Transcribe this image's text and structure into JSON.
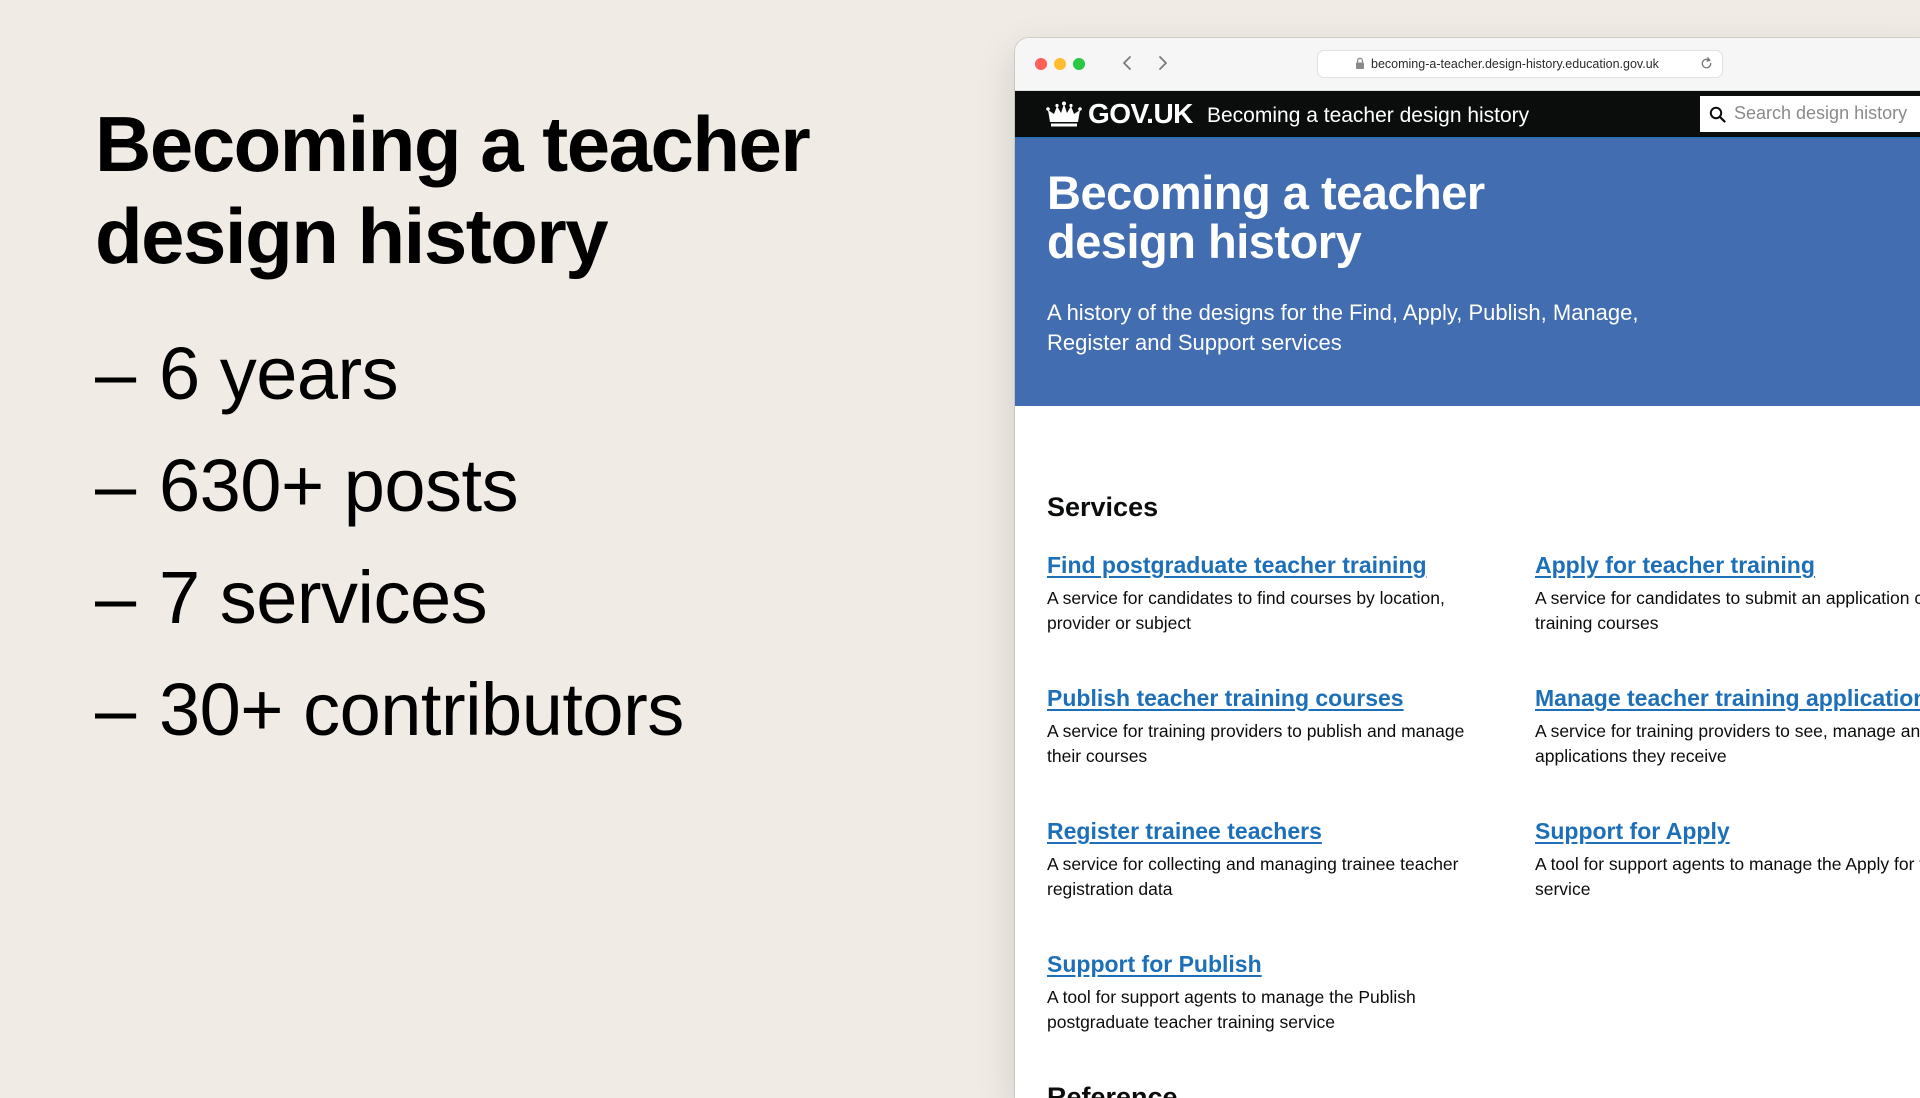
{
  "slide": {
    "title": "Becoming a teacher design history",
    "stats": [
      {
        "dash": "–",
        "text": "6 years"
      },
      {
        "dash": "–",
        "text": "630+ posts"
      },
      {
        "dash": "–",
        "text": "7 services"
      },
      {
        "dash": "–",
        "text": "30+ contributors"
      }
    ]
  },
  "browser": {
    "url": "becoming-a-teacher.design-history.education.gov.uk",
    "header": {
      "logo_text": "GOV.UK",
      "service_name": "Becoming a teacher design history",
      "search_placeholder": "Search design history"
    },
    "hero": {
      "title": "Becoming a teacher design history",
      "description": "A history of the designs for the Find, Apply, Publish, Manage, Register and Support services"
    },
    "sections": {
      "services_heading": "Services",
      "reference_heading": "Reference"
    },
    "services": [
      {
        "title": "Find postgraduate teacher training",
        "description": "A service for candidates to find courses by location, provider or subject"
      },
      {
        "title": "Apply for teacher training",
        "description": "A service for candidates to submit an application chosen teacher training courses"
      },
      {
        "title": "Publish teacher training courses",
        "description": "A service for training providers to publish and manage their courses"
      },
      {
        "title": "Manage teacher training applications",
        "description": "A service for training providers to see, manage and decisions on applications they receive"
      },
      {
        "title": "Register trainee teachers",
        "description": "A service for collecting and managing trainee teacher registration data"
      },
      {
        "title": "Support for Apply",
        "description": "A tool for support agents to manage the Apply for teacher training service"
      },
      {
        "title": "Support for Publish",
        "description": "A tool for support agents to manage the Publish postgraduate teacher training service"
      }
    ],
    "colors": {
      "hero_blue": "#426db0",
      "link_blue": "#1d70b8",
      "header_black": "#0b0c0c",
      "slide_background": "#f0ebe5"
    }
  }
}
